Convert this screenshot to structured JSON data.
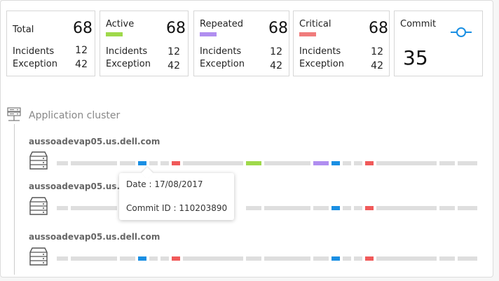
{
  "summary": {
    "total": {
      "title": "Total",
      "count": "68",
      "incidents_label": "Incidents",
      "incidents": "12",
      "exception_label": "Exception",
      "exception": "42"
    },
    "active": {
      "title": "Active",
      "count": "68",
      "incidents_label": "Incidents",
      "incidents": "12",
      "exception_label": "Exception",
      "exception": "42",
      "color": "#9fd94b"
    },
    "repeated": {
      "title": "Repeated",
      "count": "68",
      "incidents_label": "Incidents",
      "incidents": "12",
      "exception_label": "Exception",
      "exception": "42",
      "color": "#b08ef0"
    },
    "critical": {
      "title": "Critical",
      "count": "68",
      "incidents_label": "Incidents",
      "incidents": "12",
      "exception_label": "Exception",
      "exception": "42",
      "color": "#f07c7c"
    },
    "commit": {
      "title": "Commit",
      "count": "35",
      "icon": "commit-icon",
      "color": "#1a8fe3"
    }
  },
  "cluster": {
    "label": "Application cluster",
    "icon": "server-cluster-icon",
    "hosts": [
      {
        "name": "aussoadevap05.us.dell.com",
        "icon": "server-icon"
      },
      {
        "name": "aussoadevap05.us.dell.com",
        "icon": "server-icon"
      },
      {
        "name": "aussoadevap05.us.dell.com",
        "icon": "server-icon"
      }
    ]
  },
  "colors": {
    "empty": "#dedede",
    "commit": "#1a8fe3",
    "critical": "#f05a5a",
    "active": "#9fd94b",
    "repeated": "#b08ef0"
  },
  "tooltip": {
    "date": "Date : 17/08/2017",
    "commit_id": "Commit ID : 110203890"
  }
}
